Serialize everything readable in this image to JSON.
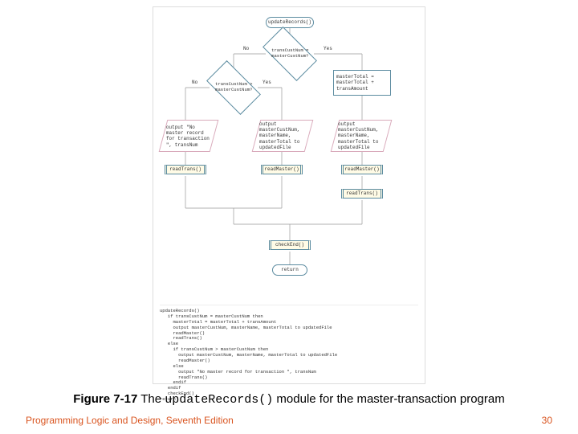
{
  "flow": {
    "start": "updateRecords()",
    "d1": "transCustNum = masterCustNum?",
    "d1_no": "No",
    "d1_yes": "Yes",
    "d2": "transCustNum > masterCustNum?",
    "d2_no": "No",
    "d2_yes": "Yes",
    "procRight": "masterTotal = masterTotal + transAmount",
    "ioLeft": "output \"No master record for transaction \", transNum",
    "ioMid": "output masterCustNum, masterName, masterTotal to updatedFile",
    "ioRight": "output masterCustNum, masterName, masterTotal to updatedFile",
    "readTrans": "readTrans()",
    "readMaster": "readMaster()",
    "readMaster2": "readMaster()",
    "readTrans2": "readTrans()",
    "checkEnd": "checkEnd()",
    "return": "return"
  },
  "pseudocode": "updateRecords()\n   if transCustNum = masterCustNum then\n     masterTotal = masterTotal + transAmount\n     output masterCustNum, masterName, masterTotal to updatedFile\n     readMaster()\n     readTrans()\n   else\n     if transCustNum > masterCustNum then\n       output masterCustNum, masterName, masterTotal to updatedFile\n       readMaster()\n     else\n       output \"No master record for transaction \", transNum\n       readTrans()\n     endif\n   endif\n   checkEnd()\nreturn",
  "caption_bold": "Figure 7-17",
  "caption_a": " The ",
  "caption_code": "updateRecords()",
  "caption_b": " module for the master-transaction program",
  "footer_left": "Programming Logic and Design, Seventh Edition",
  "footer_right": "30"
}
